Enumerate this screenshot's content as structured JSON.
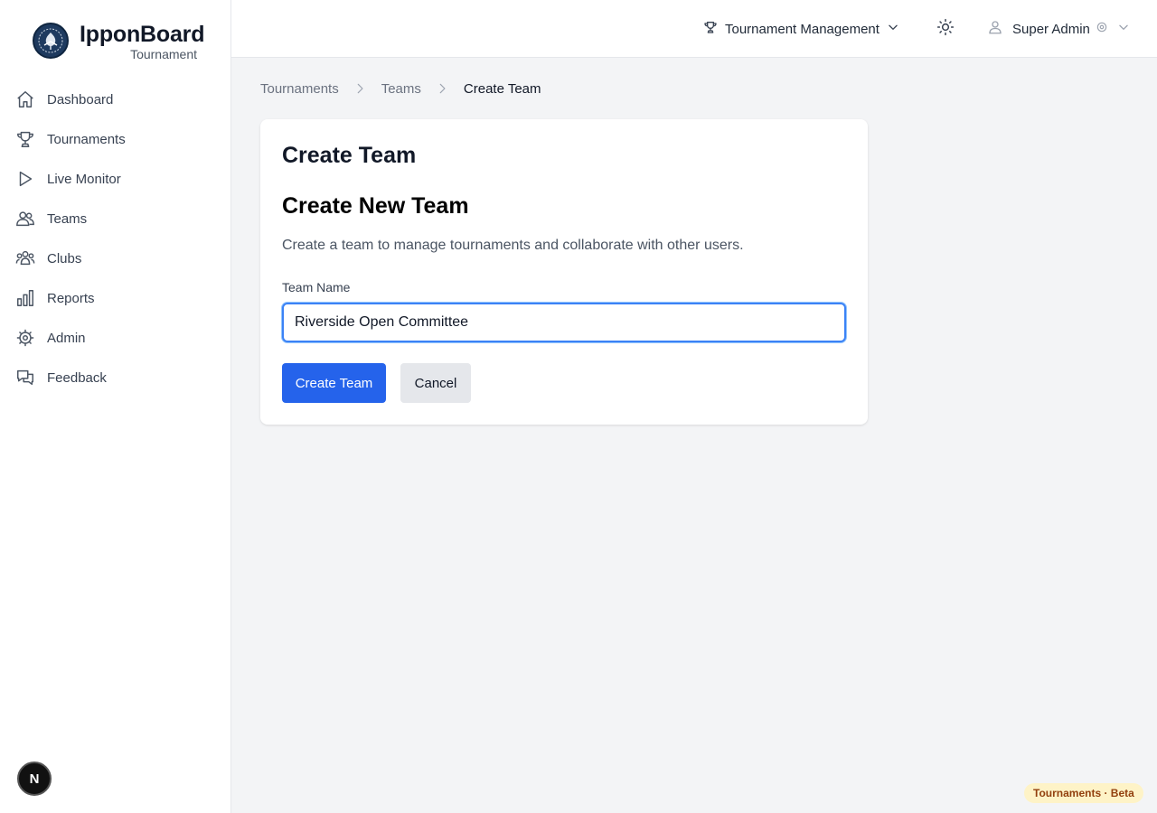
{
  "brand": {
    "name": "IpponBoard",
    "subtitle": "Tournament"
  },
  "sidebar": {
    "items": [
      {
        "label": "Dashboard",
        "icon": "home-icon"
      },
      {
        "label": "Tournaments",
        "icon": "trophy-icon"
      },
      {
        "label": "Live Monitor",
        "icon": "play-icon"
      },
      {
        "label": "Teams",
        "icon": "users-icon"
      },
      {
        "label": "Clubs",
        "icon": "user-group-icon"
      },
      {
        "label": "Reports",
        "icon": "bar-chart-icon"
      },
      {
        "label": "Admin",
        "icon": "cog-icon"
      },
      {
        "label": "Feedback",
        "icon": "chat-bubbles-icon"
      }
    ]
  },
  "header": {
    "workspace_label": "Tournament Management",
    "user_label": "Super Admin"
  },
  "breadcrumb": [
    "Tournaments",
    "Teams",
    "Create Team"
  ],
  "card": {
    "title": "Create Team",
    "form_title": "Create New Team",
    "description": "Create a team to manage tournaments and collaborate with other users.",
    "field_label": "Team Name",
    "field_value": "Riverside Open Committee",
    "submit_label": "Create Team",
    "cancel_label": "Cancel"
  },
  "dev_badge_label": "N",
  "beta_badge": "Tournaments · Beta",
  "colors": {
    "primary": "#2563eb",
    "focus_ring": "#3b82f6",
    "badge_bg": "#fef3c7",
    "badge_text": "#92400e"
  }
}
